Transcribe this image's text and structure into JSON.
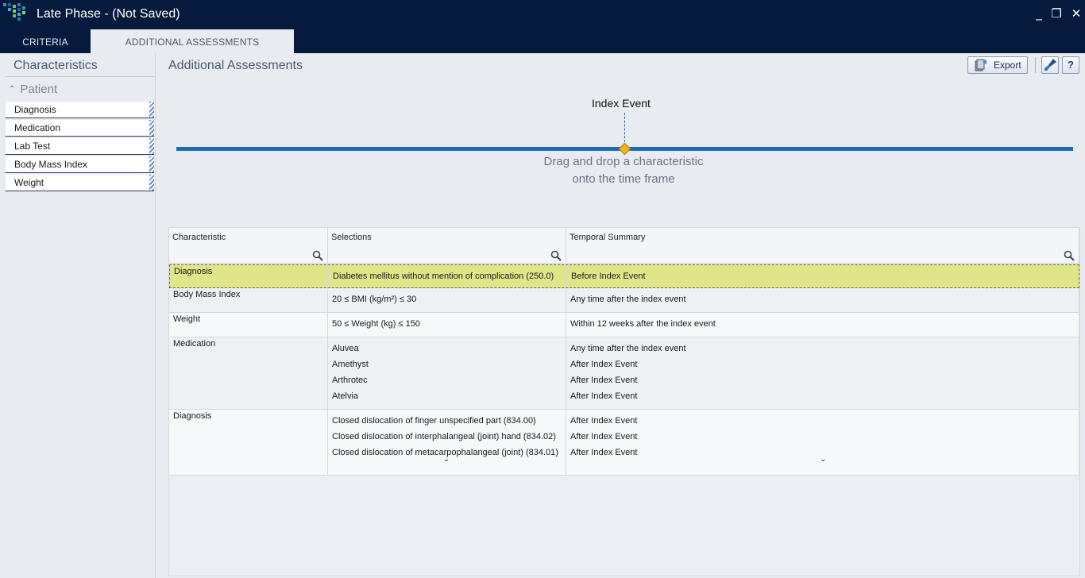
{
  "window": {
    "title": "Late Phase - (Not Saved)",
    "minimize": "_",
    "restore": "❐",
    "close": "✕"
  },
  "tabs": [
    {
      "label": "CRITERIA"
    },
    {
      "label": "ADDITIONAL ASSESSMENTS"
    }
  ],
  "sidebar": {
    "title": "Characteristics",
    "group": {
      "label": "Patient",
      "toggle": "⌃"
    },
    "items": [
      {
        "label": "Diagnosis"
      },
      {
        "label": "Medication"
      },
      {
        "label": "Lab Test"
      },
      {
        "label": "Body Mass Index"
      },
      {
        "label": "Weight"
      }
    ]
  },
  "main": {
    "title": "Additional Assessments",
    "toolbar": {
      "export_label": "Export",
      "help_label": "?"
    },
    "timeline": {
      "index_label": "Index Event",
      "hint_line1": "Drag and drop a characteristic",
      "hint_line2": "onto the time frame"
    },
    "grid": {
      "columns": [
        "Characteristic",
        "Selections",
        "Temporal Summary"
      ],
      "rows": [
        {
          "characteristic": "Diagnosis",
          "selections": [
            "Diabetes mellitus without mention of complication (250.0)"
          ],
          "temporal": [
            "Before Index Event"
          ]
        },
        {
          "characteristic": "Body Mass Index",
          "selections": [
            "20 ≤ BMI (kg/m²) ≤ 30"
          ],
          "temporal": [
            "Any time after the index event"
          ]
        },
        {
          "characteristic": "Weight",
          "selections": [
            "50 ≤ Weight (kg) ≤ 150"
          ],
          "temporal": [
            "Within 12 weeks after the index event"
          ]
        },
        {
          "characteristic": "Medication",
          "selections": [
            "Aluvea",
            "Amethyst",
            "Arthrotec",
            "Atelvia"
          ],
          "temporal": [
            "Any time after the index event",
            "After Index Event",
            "After Index Event",
            "After Index Event"
          ]
        },
        {
          "characteristic": "Diagnosis",
          "selections": [
            "Closed dislocation of finger unspecified part (834.00)",
            "Closed dislocation of interphalangeal (joint) hand (834.02)",
            "Closed dislocation of metacarpophalangeal (joint) (834.01)"
          ],
          "temporal": [
            "After Index Event",
            "After Index Event",
            "After Index Event"
          ]
        }
      ],
      "expand_glyph": "⌄"
    }
  },
  "colors": {
    "titlebar": "#051a3c",
    "timeline": "#1d6bb8",
    "marker": "#f2b21a",
    "selected_row": "#dfe68a"
  }
}
